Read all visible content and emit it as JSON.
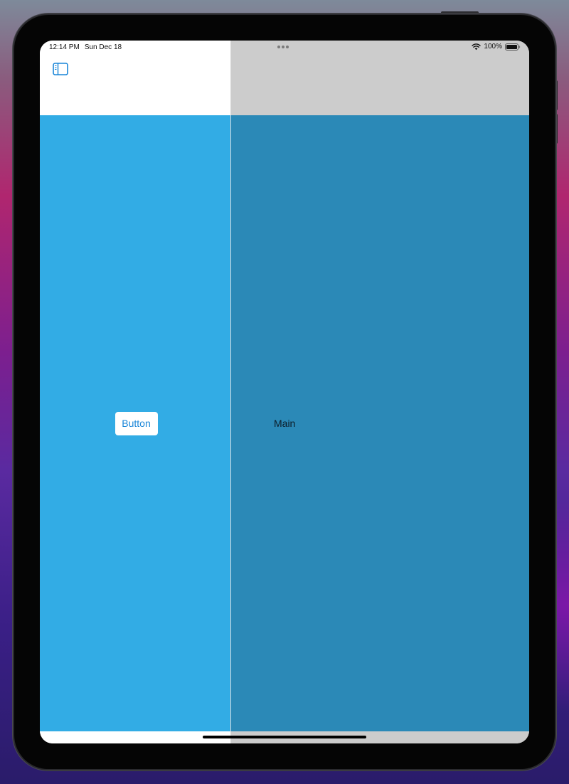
{
  "status_bar": {
    "time": "12:14 PM",
    "date": "Sun Dec 18",
    "battery_percent": "100%",
    "icons": [
      "wifi-icon",
      "battery-icon"
    ]
  },
  "navigation": {
    "sidebar_toggle_icon": "sidebar-toggle-icon"
  },
  "sidebar": {
    "button_label": "Button",
    "background": "#32ace5"
  },
  "main": {
    "label": "Main",
    "background": "#2b89b7"
  },
  "colors": {
    "accent": "#1a86d8",
    "nav_bar_sidebar": "#ffffff",
    "nav_bar_main": "#cccccc"
  }
}
